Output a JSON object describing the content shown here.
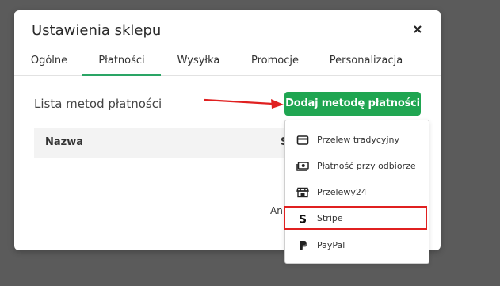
{
  "modal": {
    "title": "Ustawienia sklepu"
  },
  "tabs": [
    {
      "label": "Ogólne",
      "active": false
    },
    {
      "label": "Płatności",
      "active": true
    },
    {
      "label": "Wysyłka",
      "active": false
    },
    {
      "label": "Promocje",
      "active": false
    },
    {
      "label": "Personalizacja",
      "active": false
    }
  ],
  "section": {
    "title": "Lista metod płatności"
  },
  "table": {
    "columns": [
      "Nazwa",
      "S"
    ]
  },
  "partial_text": "An",
  "add_button": {
    "label": "Dodaj metodę płatności"
  },
  "dropdown": {
    "items": [
      {
        "label": "Przelew tradycyjny",
        "icon": "credit-card-icon"
      },
      {
        "label": "Płatność przy odbiorze",
        "icon": "cash-icon"
      },
      {
        "label": "Przelewy24",
        "icon": "store-icon"
      },
      {
        "label": "Stripe",
        "icon": "stripe-icon"
      },
      {
        "label": "PayPal",
        "icon": "paypal-icon"
      }
    ]
  },
  "colors": {
    "accent": "#1fa551",
    "tab_underline": "#2aa565",
    "annotation": "#e02020",
    "backdrop": "#5b5b5b"
  }
}
